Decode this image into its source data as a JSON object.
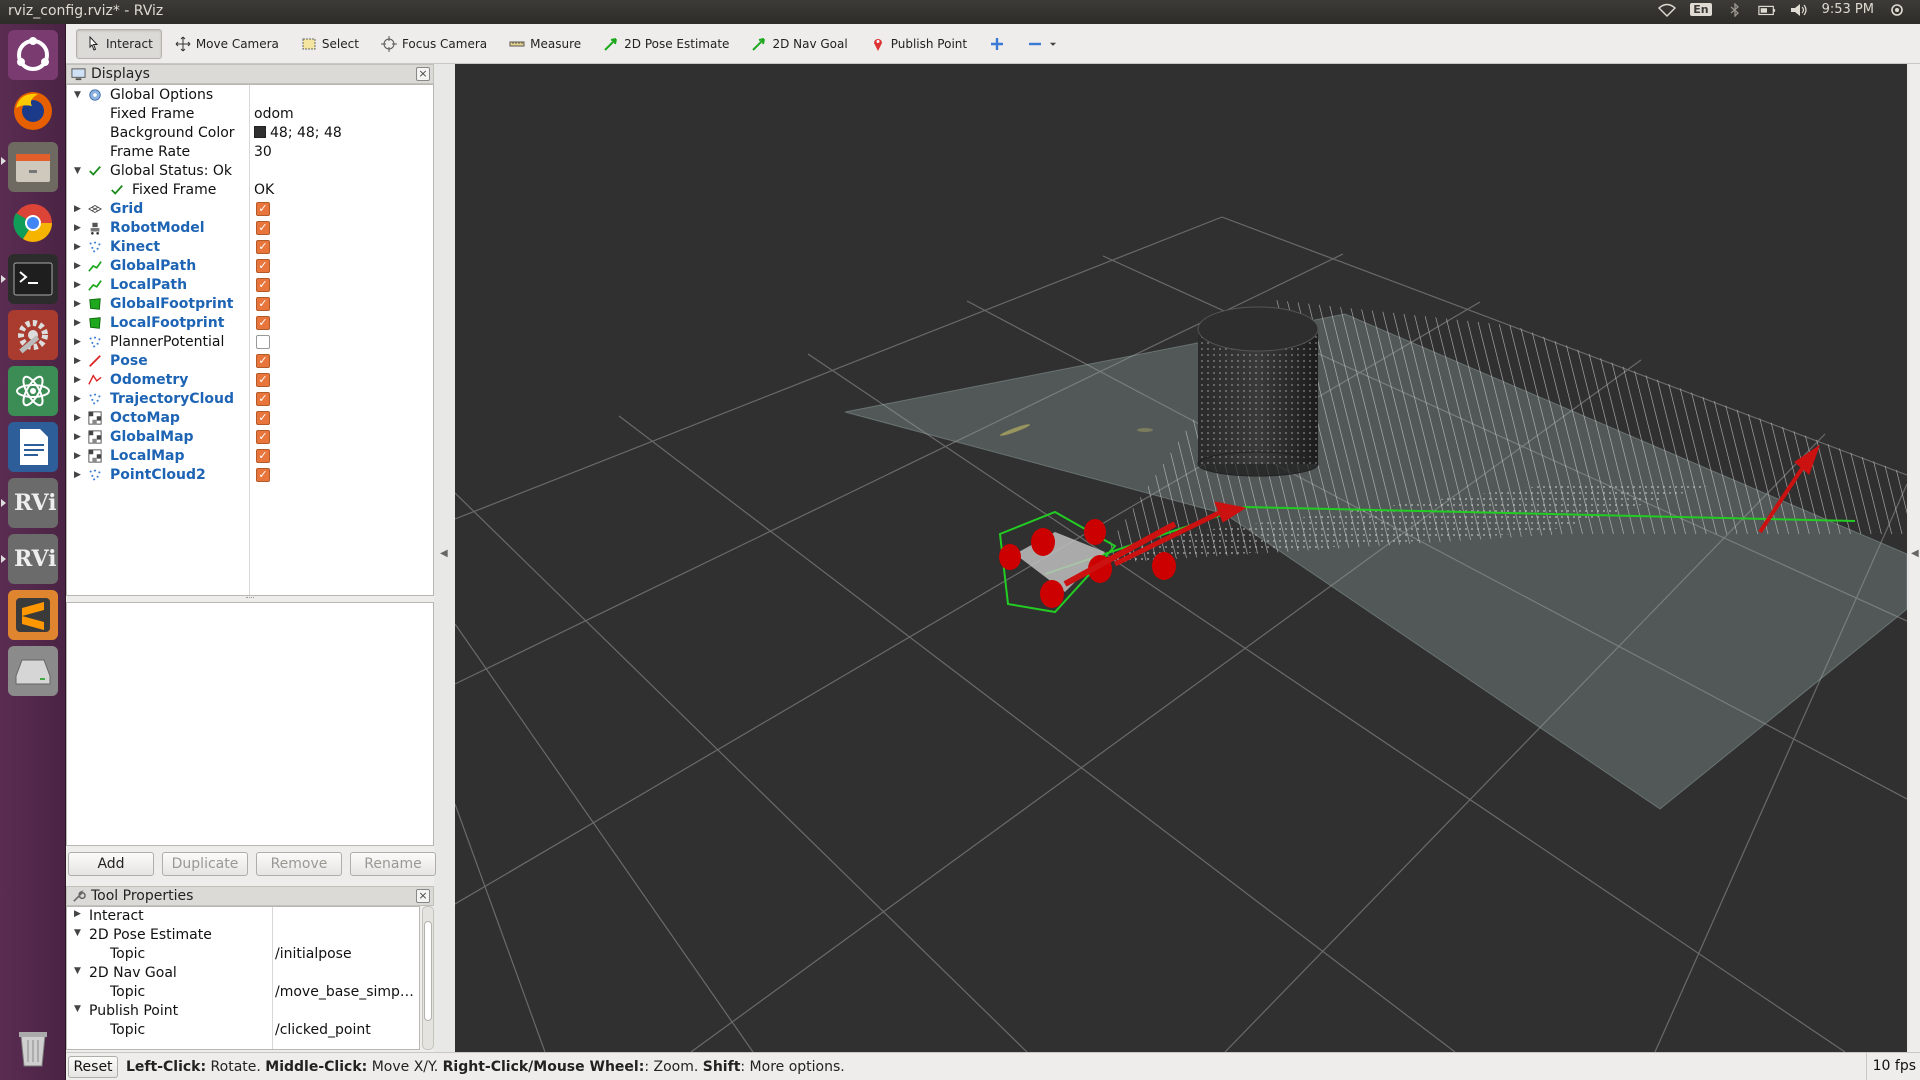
{
  "window": {
    "title": "rviz_config.rviz* - RViz"
  },
  "system_tray": {
    "language": "En",
    "clock": "9:53 PM"
  },
  "launcher": {
    "items": [
      "ubuntu-dash",
      "firefox",
      "files",
      "chrome",
      "terminal",
      "system-settings",
      "atom",
      "libreoffice-writer",
      "rviz",
      "rviz",
      "sublime-text",
      "disk-drive",
      "trash"
    ]
  },
  "toolbar": {
    "tools": [
      {
        "label": "Interact",
        "icon": "cursor-icon"
      },
      {
        "label": "Move Camera",
        "icon": "move-icon"
      },
      {
        "label": "Select",
        "icon": "select-box-icon"
      },
      {
        "label": "Focus Camera",
        "icon": "crosshair-icon"
      },
      {
        "label": "Measure",
        "icon": "ruler-icon"
      },
      {
        "label": "2D Pose Estimate",
        "icon": "green-arrow-icon"
      },
      {
        "label": "2D Nav Goal",
        "icon": "green-arrow-icon"
      },
      {
        "label": "Publish Point",
        "icon": "map-pin-icon"
      }
    ],
    "add_tool": "plus-icon",
    "remove_tool": "minus-icon"
  },
  "displays": {
    "header": "Displays",
    "global_options": {
      "label": "Global Options",
      "fixed_frame_label": "Fixed Frame",
      "fixed_frame_value": "odom",
      "background_color_label": "Background Color",
      "background_color_value": "48; 48; 48",
      "background_color_hex": "#303030",
      "frame_rate_label": "Frame Rate",
      "frame_rate_value": "30"
    },
    "global_status": {
      "label": "Global Status: Ok",
      "fixed_frame_label": "Fixed Frame",
      "fixed_frame_value": "OK"
    },
    "items": [
      {
        "label": "Grid",
        "enabled": true
      },
      {
        "label": "RobotModel",
        "enabled": true
      },
      {
        "label": "Kinect",
        "enabled": true
      },
      {
        "label": "GlobalPath",
        "enabled": true
      },
      {
        "label": "LocalPath",
        "enabled": true
      },
      {
        "label": "GlobalFootprint",
        "enabled": true
      },
      {
        "label": "LocalFootprint",
        "enabled": true
      },
      {
        "label": "PlannerPotential",
        "enabled": false
      },
      {
        "label": "Pose",
        "enabled": true
      },
      {
        "label": "Odometry",
        "enabled": true
      },
      {
        "label": "TrajectoryCloud",
        "enabled": true
      },
      {
        "label": "OctoMap",
        "enabled": true
      },
      {
        "label": "GlobalMap",
        "enabled": true
      },
      {
        "label": "LocalMap",
        "enabled": true
      },
      {
        "label": "PointCloud2",
        "enabled": true
      }
    ],
    "buttons": {
      "add": "Add",
      "duplicate": "Duplicate",
      "remove": "Remove",
      "rename": "Rename"
    }
  },
  "tool_properties": {
    "header": "Tool Properties",
    "rows": [
      {
        "label": "Interact",
        "value": ""
      },
      {
        "label": "2D Pose Estimate",
        "value": ""
      },
      {
        "label": "Topic",
        "value": "/initialpose"
      },
      {
        "label": "2D Nav Goal",
        "value": ""
      },
      {
        "label": "Topic",
        "value": "/move_base_simp…"
      },
      {
        "label": "Publish Point",
        "value": ""
      },
      {
        "label": "Topic",
        "value": "/clicked_point"
      }
    ]
  },
  "statusbar": {
    "reset": "Reset",
    "left_click": "Left-Click:",
    "left_click_desc": " Rotate. ",
    "middle_click": "Middle-Click:",
    "middle_click_desc": " Move X/Y. ",
    "right_click": "Right-Click/Mouse Wheel:",
    "right_click_desc": ": Zoom. ",
    "shift": "Shift",
    "shift_desc": ": More options.",
    "fps": "10 fps"
  }
}
